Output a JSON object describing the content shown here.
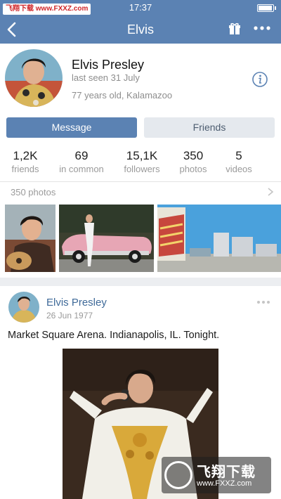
{
  "status_bar": {
    "watermark": "飞翔下载 www.FXXZ.com",
    "time": "17:37",
    "battery_level": 0.9
  },
  "nav": {
    "title": "Elvis"
  },
  "profile": {
    "name": "Elvis Presley",
    "last_seen": "last seen 31 July",
    "age_city": "77 years old, Kalamazoo"
  },
  "actions": {
    "message": "Message",
    "friends": "Friends"
  },
  "stats": [
    {
      "value": "1,2K",
      "label": "friends"
    },
    {
      "value": "69",
      "label": "in common"
    },
    {
      "value": "15,1K",
      "label": "followers"
    },
    {
      "value": "350",
      "label": "photos"
    },
    {
      "value": "5",
      "label": "videos"
    }
  ],
  "photos_section": {
    "label": "350 photos"
  },
  "post": {
    "author": "Elvis Presley",
    "date": "26 Jun 1977",
    "text": "Market Square Arena. Indianapolis, IL. Tonight."
  },
  "watermark_bottom": {
    "brand": "飞翔下载",
    "url": "www.FXXZ.com"
  },
  "colors": {
    "accent": "#5b82b3",
    "link": "#3f6a99"
  }
}
